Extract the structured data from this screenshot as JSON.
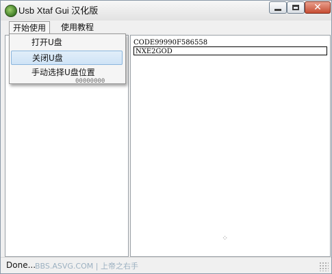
{
  "window": {
    "title": "Usb Xtaf Gui 汉化版",
    "app_icon": "green-circle-icon",
    "controls": [
      "minimize-icon",
      "maximize-icon",
      "close-icon"
    ]
  },
  "menubar": {
    "items": [
      {
        "label": "开始使用",
        "open": true
      },
      {
        "label": "使用教程",
        "open": false
      }
    ]
  },
  "dropdown": {
    "items": [
      {
        "label": "打开U盘",
        "highlighted": false
      },
      {
        "label": "关闭U盘",
        "highlighted": true
      },
      {
        "label": "手动选择U盘位置",
        "highlighted": false
      }
    ],
    "partially_hidden_text": "00000000"
  },
  "right_pane": {
    "lines": [
      "CODE99990F586558",
      "NXE2GOD"
    ]
  },
  "status": {
    "text": "Done...",
    "watermark": "BBS.ASVG.COM | 上帝之右手"
  },
  "colors": {
    "highlight": "#cfe3f6",
    "close_button": "#c64d33"
  }
}
